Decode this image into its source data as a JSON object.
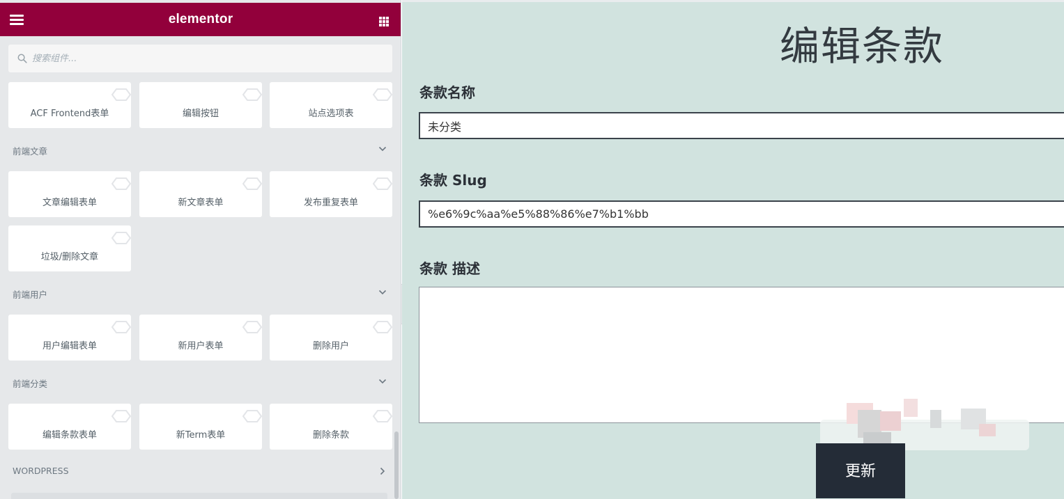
{
  "header": {
    "logo": "elementor",
    "menu_icon": "hamburger-icon",
    "apps_icon": "grid-icon",
    "brand_color": "#92003b"
  },
  "search": {
    "placeholder": "搜索组件..."
  },
  "sections": [
    {
      "title": "",
      "widgets": [
        "ACF Frontend表单",
        "编辑按钮",
        "站点选项表"
      ]
    },
    {
      "title": "前端文章",
      "widgets": [
        "文章编辑表单",
        "新文章表单",
        "发布重复表单",
        "垃圾/删除文章"
      ]
    },
    {
      "title": "前端用户",
      "widgets": [
        "用户编辑表单",
        "新用户表单",
        "删除用户"
      ]
    },
    {
      "title": "前端分类",
      "widgets": [
        "编辑条款表单",
        "新Term表单",
        "删除条款"
      ]
    },
    {
      "title": "WORDPRESS",
      "widgets": []
    }
  ],
  "form": {
    "title": "编辑条款",
    "name_label": "条款名称",
    "name_value": "未分类",
    "slug_label": "条款 Slug",
    "slug_value": "%e6%9c%aa%e5%88%86%e7%b1%bb",
    "description_label": "条款 描述",
    "description_value": "",
    "submit_label": "更新"
  },
  "colors": {
    "preview_background": "#d1e3df",
    "submit_background": "#242c37",
    "sidebar_background": "#e6e8ea"
  }
}
